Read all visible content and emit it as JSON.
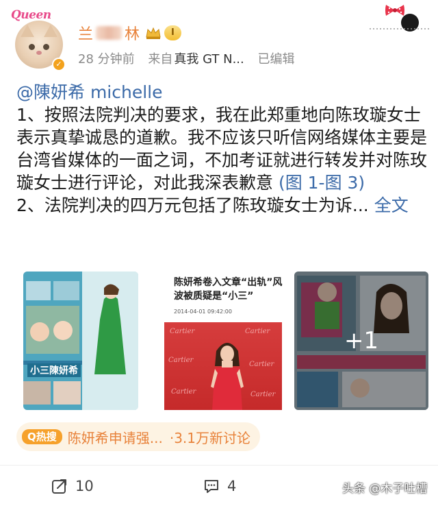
{
  "header": {
    "avatar_badge": "Queen",
    "name_start": "兰",
    "name_end": "林",
    "level": "I",
    "time": "28 分钟前",
    "source_prefix": "来自",
    "source_device": "真我 GT N...",
    "edited": "已编辑"
  },
  "post": {
    "mention": "@陳妍希 michelle",
    "para1_text": "1、按照法院判决的要求，我在此郑重地向陈玫璇女士表示真挚诚恳的道歉。我不应该只听信网络媒体主要是台湾省媒体的一面之词，不加考证就进行转发并对陈玫璇女士进行评论，对此我深表歉意 ",
    "para1_link": "(图 1-图 3)",
    "para2_text": "2、法院判决的四万元包括了陈玫璇女士为诉... ",
    "more_label": "全文"
  },
  "images": {
    "img1_caption": "小三陳妍希",
    "img2_title": "陈妍希卷入文章“出轨”风波被质疑是“小三”",
    "img2_meta": "2014-04-01 09:42:00",
    "img2_brand": "Cartier",
    "more_count": "+1"
  },
  "trend": {
    "tag": "Q热搜",
    "title": "陈妍希申请强...",
    "count": "·3.1万新讨论"
  },
  "actions": {
    "repost_count": "10",
    "comment_count": "4"
  },
  "watermark": "头条 @木子吐槽",
  "colors": {
    "accent_orange": "#e8823a",
    "link_blue": "#3b6aa8",
    "trend_bg": "#fdf3e3"
  }
}
